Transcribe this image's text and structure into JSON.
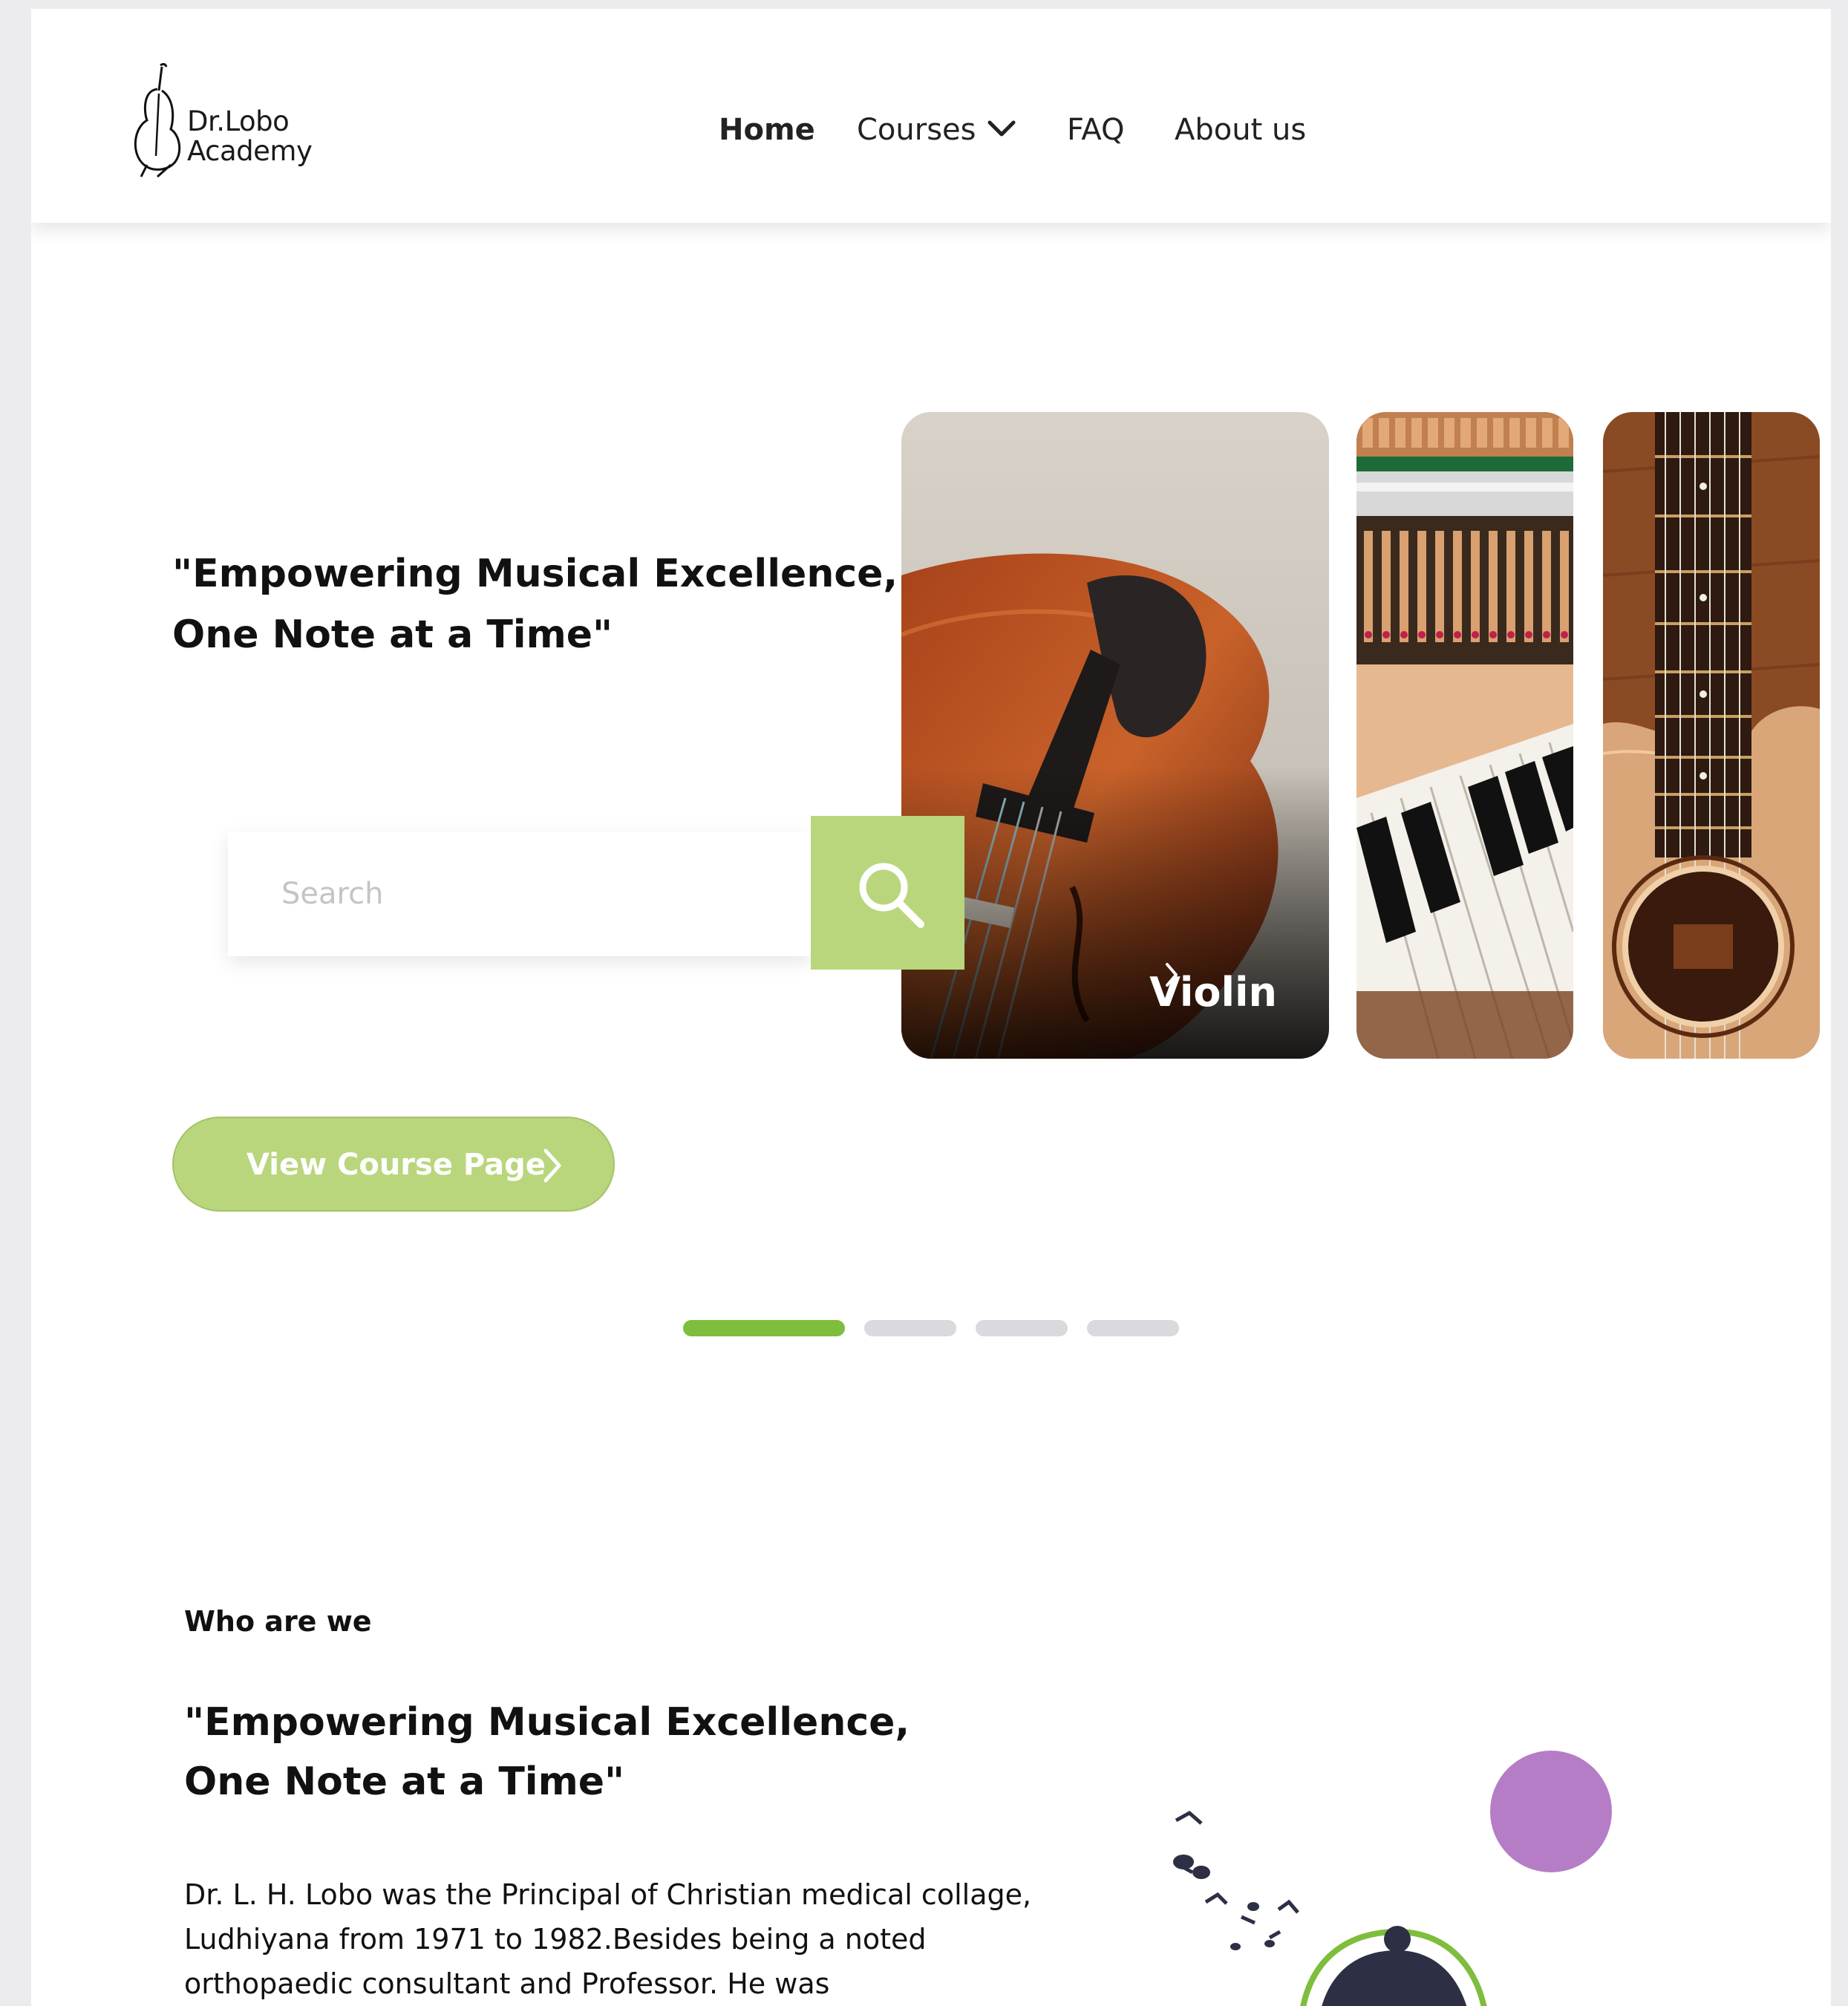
{
  "brand": {
    "line1": "Dr.Lobo",
    "line2": "Academy"
  },
  "nav": {
    "home": "Home",
    "courses": "Courses",
    "faq": "FAQ",
    "about": "About us"
  },
  "hero": {
    "title_line1": "\"Empowering Musical Excellence,",
    "title_line2": "One Note at a Time\"",
    "search_placeholder": "Search",
    "cta_label": "View Course Page",
    "cards": [
      {
        "label": "Violin"
      },
      {
        "label": ""
      },
      {
        "label": ""
      }
    ],
    "pagination": {
      "total": 4,
      "active": 1
    }
  },
  "about": {
    "section_label": "Who are we",
    "title_line1": "\"Empowering Musical Excellence,",
    "title_line2": "One Note at a Time\"",
    "body": "Dr. L. H. Lobo was the Principal of Christian medical collage, Ludhiyana from 1971 to 1982.Besides being a noted orthopaedic consultant and Professor. He was"
  },
  "colors": {
    "accent_green": "#b9d67c",
    "active_dot": "#7fbd3d",
    "inactive_dot": "#d9d9de",
    "purple_circle": "#b57dc5"
  },
  "icons": [
    "cello-logo-icon",
    "chevron-down-icon",
    "search-icon",
    "chevron-right-icon",
    "music-notes-icon"
  ]
}
